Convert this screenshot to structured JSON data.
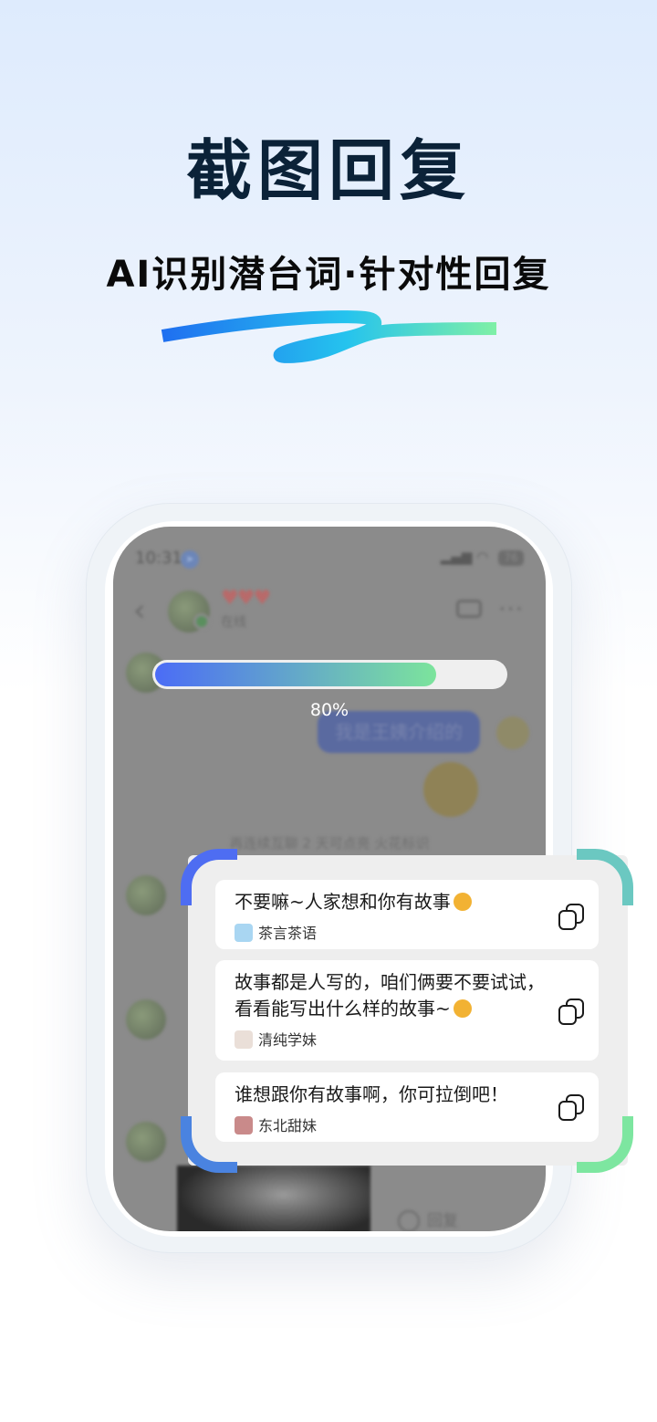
{
  "header": {
    "title": "截图回复",
    "subtitle": "AI识别潜台词·针对性回复"
  },
  "colors": {
    "accent_blue": "#4b6cf6",
    "accent_green": "#7ce49c",
    "title": "#0b2238"
  },
  "phone": {
    "status": {
      "time": "10:31",
      "battery": "76"
    },
    "chat": {
      "contact_name_icons": "♥♥♥",
      "contact_status": "在线",
      "message_right": "我是王姨介绍的",
      "fire_hint": "再连续互聊 2 天可点亮 火花标识",
      "reply_hint": "回复"
    },
    "progress": {
      "percent": 80,
      "label": "80%"
    }
  },
  "replies": [
    {
      "text": "不要嘛~人家想和你有故事",
      "source": "茶言茶语",
      "source_icon": "anime-girl-icon"
    },
    {
      "text": "故事都是人写的，咱们俩要不要试试，看看能写出什么样的故事~",
      "source": "清纯学妹",
      "source_icon": "girl-sketch-icon"
    },
    {
      "text": "谁想跟你有故事啊，你可拉倒吧！",
      "source": "东北甜妹",
      "source_icon": "girl-portrait-icon"
    }
  ]
}
